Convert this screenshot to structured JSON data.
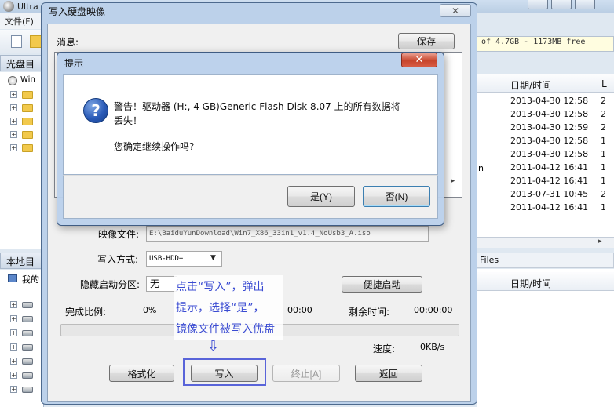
{
  "main_window": {
    "title": "Ultra",
    "menu_file": "文件(F)",
    "cd_panel_label": "光盘目",
    "cd_root_label": "Win",
    "local_panel_label": "本地目",
    "local_root_label": "我的",
    "size_info": "of 4.7GB - 1173MB free",
    "date_header": "日期/时间",
    "l_header": "L",
    "n_fragment": "n",
    "dates": [
      "2013-04-30 12:58",
      "2013-04-30 12:58",
      "2013-04-30 12:59",
      "2013-04-30 12:58",
      "2013-04-30 12:58",
      "2011-04-12 16:41",
      "2011-04-12 16:41",
      "2013-07-31 10:45",
      "2011-04-12 16:41"
    ],
    "l_values": [
      "2",
      "2",
      "2",
      "1",
      "1",
      "1",
      "1",
      "2",
      "1"
    ],
    "files_label": "Files",
    "date_header_bottom": "日期/时间"
  },
  "write_dialog": {
    "title": "写入硬盘映像",
    "close_glyph": "✕",
    "message_label": "消息:",
    "save_button": "保存",
    "image_file_label": "映像文件:",
    "image_file_value": "E:\\BaiduYunDownload\\Win7_X86_33in1_v1.4_NoUsb3_A.iso",
    "write_method_label": "写入方式:",
    "write_method_value": "USB-HDD+",
    "hidden_partition_label": "隐藏启动分区:",
    "hidden_partition_value": "无",
    "quick_boot_button": "便捷启动",
    "percent_label": "完成比例:",
    "percent_value": "0%",
    "progress_percent": 0,
    "elapsed_value": "00:00",
    "remaining_label": "剩余时间:",
    "remaining_value": "00:00:00",
    "speed_label": "速度:",
    "speed_value": "0KB/s",
    "format_button": "格式化",
    "write_button": "写入",
    "abort_button": "终止[A]",
    "return_button": "返回"
  },
  "annotation": {
    "lines": [
      "点击“写入”，弹出",
      "提示，选择“是”，",
      "镜像文件被写入优盘"
    ],
    "arrow_glyph": "⇩"
  },
  "confirm_dialog": {
    "title": "提示",
    "close_glyph": "✕",
    "icon_glyph": "?",
    "warning_line1": "警告！驱动器 (H:, 4 GB)Generic Flash Disk      8.07 上的所有数据将",
    "warning_line2": "丢失！",
    "question": "您确定继续操作吗?",
    "yes_button": "是(Y)",
    "no_button": "否(N)"
  }
}
